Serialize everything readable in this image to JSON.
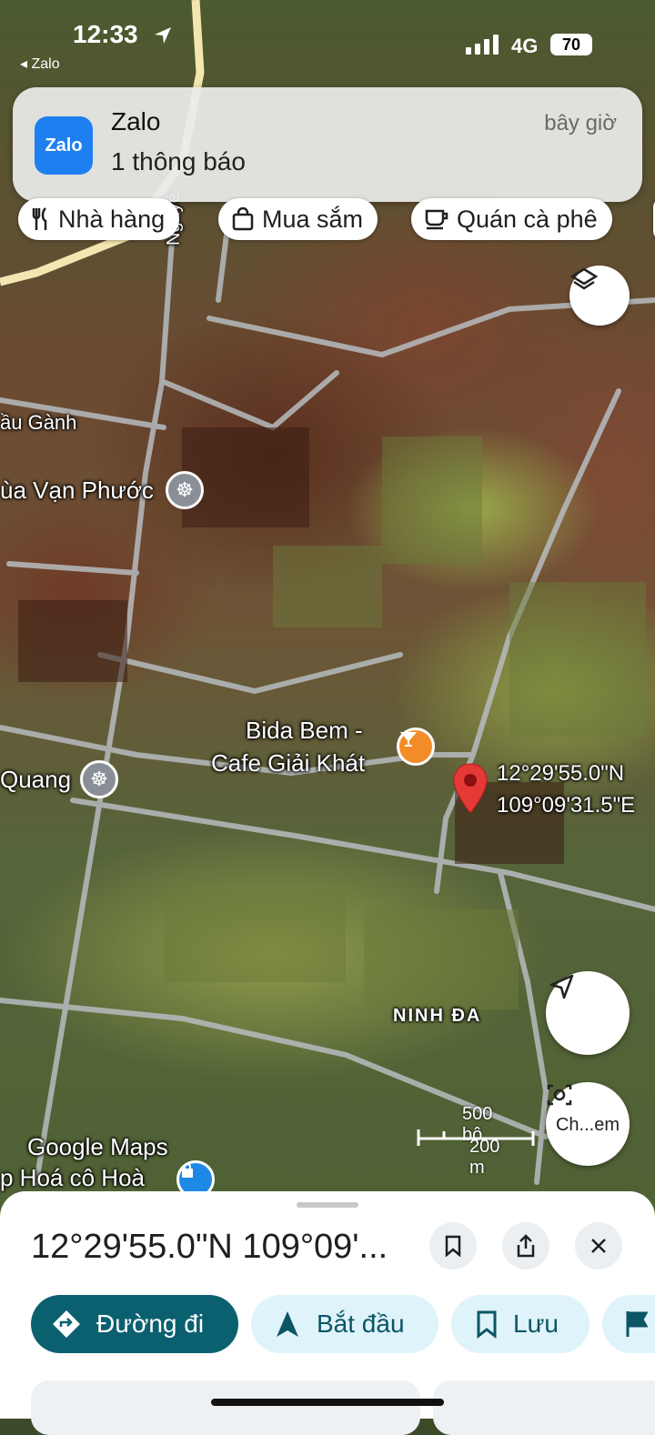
{
  "status_bar": {
    "time": "12:33",
    "back_app": "◂ Zalo",
    "network": "4G",
    "battery": "70"
  },
  "notification": {
    "app_name": "Zalo",
    "icon_text": "Zalo",
    "message": "1 thông báo",
    "time": "bây giờ"
  },
  "category_chips": [
    {
      "label": "Nhà hàng",
      "icon": "fork-knife-icon"
    },
    {
      "label": "Mua sắm",
      "icon": "shopping-bag-icon"
    },
    {
      "label": "Quán cà phê",
      "icon": "coffee-cup-icon"
    }
  ],
  "map": {
    "labels": {
      "road": "Nguyễ",
      "area1": "ầu Gành",
      "pagoda1": "ùa Vạn Phước",
      "pagoda2": "Quang",
      "cafe_line1": "Bida Bem -",
      "cafe_line2": "Cafe Giải Khát",
      "district": "NINH ĐA",
      "shop": "p Hoá cô Hoà",
      "coord_lat": "12°29'55.0\"N",
      "coord_lon": "109°09'31.5\"E"
    },
    "watermark": "Google Maps",
    "scale": {
      "imperial": "500 bộ",
      "metric": "200 m"
    },
    "buttons": {
      "street_view_label": "Ch...em"
    }
  },
  "sheet": {
    "title": "12°29'55.0\"N 109°09'...",
    "actions": [
      {
        "label": "Đường đi",
        "icon": "directions-icon"
      },
      {
        "label": "Bắt đầu",
        "icon": "navigation-arrow-icon"
      },
      {
        "label": "Lưu",
        "icon": "bookmark-icon"
      }
    ]
  },
  "colors": {
    "accent_dark_teal": "#0b6070",
    "chip_bg": "#dff3fb",
    "pin_red": "#e53935"
  }
}
